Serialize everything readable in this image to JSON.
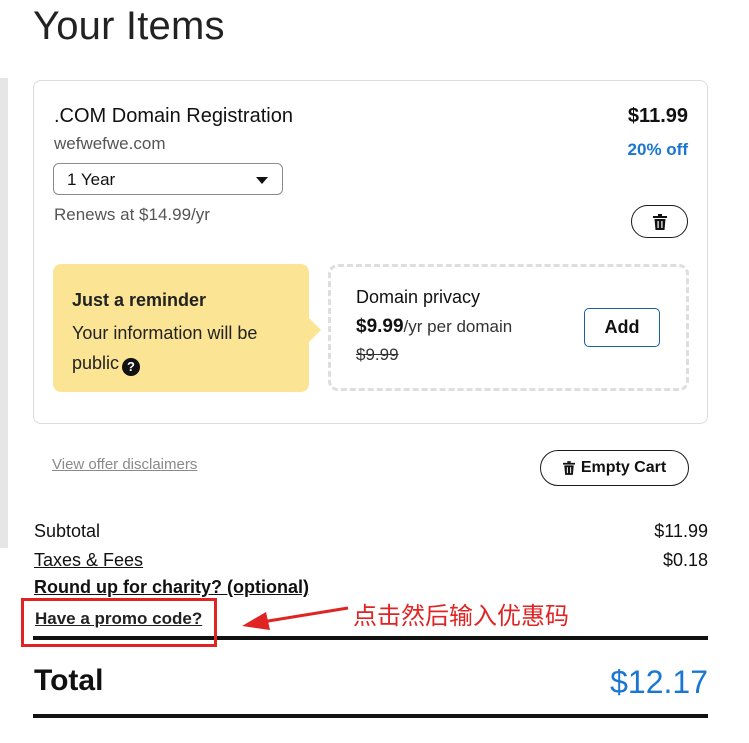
{
  "page": {
    "title": "Your Items"
  },
  "cart_item": {
    "product": ".COM Domain Registration",
    "domain": "wefwefwe.com",
    "price": "$11.99",
    "discount": "20% off",
    "term_selected": "1 Year",
    "renews": "Renews at $14.99/yr",
    "delete_icon": "trash-icon"
  },
  "reminder": {
    "title": "Just a reminder",
    "body": "Your information will be public",
    "icon": "question-circle-icon"
  },
  "privacy_upsell": {
    "title": "Domain privacy",
    "price": "$9.99",
    "price_suffix": "/yr per domain",
    "original_price": "$9.99",
    "add_label": "Add"
  },
  "links": {
    "disclaimers": "View offer disclaimers"
  },
  "actions": {
    "empty_cart": "Empty Cart",
    "empty_cart_icon": "trash-icon"
  },
  "summary": {
    "subtotal_label": "Subtotal",
    "subtotal_value": "$11.99",
    "taxes_label": "Taxes & Fees",
    "taxes_value": "$0.18",
    "charity_label": "Round up for charity? (optional)",
    "promo_label": "Have a promo code?",
    "total_label": "Total",
    "total_value": "$12.17"
  },
  "annotation": {
    "text": "点击然后输入优惠码",
    "color": "#e02424"
  },
  "colors": {
    "accent": "#1976d2",
    "reminder_bg": "#fbe594"
  }
}
